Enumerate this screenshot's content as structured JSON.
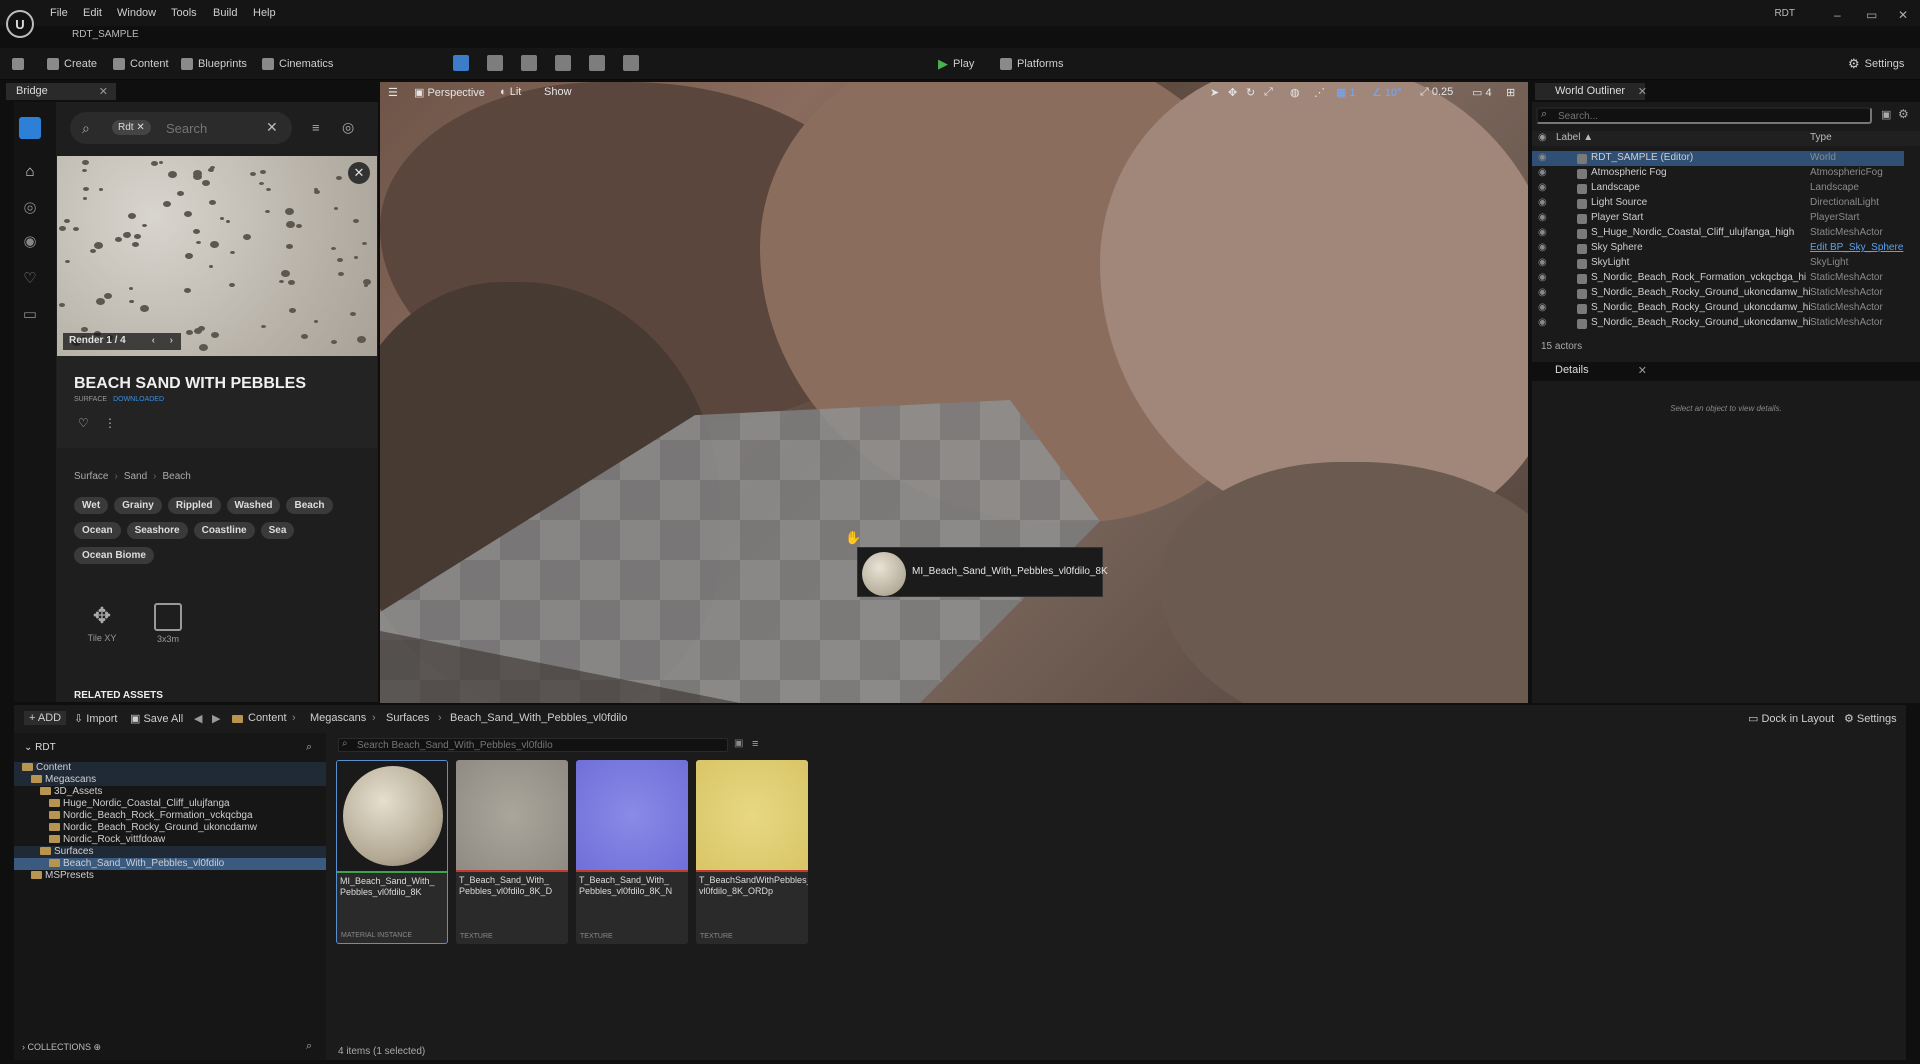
{
  "app": {
    "logo": "U",
    "menu": [
      "File",
      "Edit",
      "Window",
      "Tools",
      "Build",
      "Help"
    ],
    "project_tab": "RDT_SAMPLE",
    "project_short": "RDT",
    "window_controls": [
      "–",
      "▭",
      "✕"
    ]
  },
  "toolbar": {
    "save_icon": "save-icon",
    "create": "Create",
    "content": "Content",
    "blueprints": "Blueprints",
    "cinematics": "Cinematics",
    "play": "Play",
    "platforms": "Platforms",
    "settings": "Settings",
    "play_color": "#4caf50"
  },
  "bridge": {
    "tab": "Bridge",
    "search_chip": "Rdt",
    "search_placeholder": "Search",
    "render_label": "Render 1 / 4",
    "asset_title": "BEACH SAND WITH PEBBLES",
    "asset_type": "SURFACE",
    "asset_status": "DOWNLOADED",
    "status_color": "#3b8fe0",
    "breadcrumb": [
      "Surface",
      "Sand",
      "Beach"
    ],
    "tags": [
      "Wet",
      "Grainy",
      "Rippled",
      "Washed",
      "Beach",
      "Ocean",
      "Seashore",
      "Coastline",
      "Sea",
      "Ocean Biome"
    ],
    "tile_label": "Tile XY",
    "size_label": "3x3m",
    "related_title": "RELATED ASSETS"
  },
  "viewport": {
    "perspective": "Perspective",
    "lit": "Lit",
    "show": "Show",
    "grid_value": "1",
    "angle_value": "10°",
    "scale_value": "0.25",
    "camera_speed": "4",
    "drag_asset": "MI_Beach_Sand_With_Pebbles_vl0fdilo_8K"
  },
  "outliner": {
    "tab": "World Outliner",
    "search_placeholder": "Search...",
    "col_label": "Label ▲",
    "col_type": "Type",
    "rows": [
      {
        "label": "RDT_SAMPLE (Editor)",
        "type": "World"
      },
      {
        "label": "Atmospheric Fog",
        "type": "AtmosphericFog"
      },
      {
        "label": "Landscape",
        "type": "Landscape"
      },
      {
        "label": "Light Source",
        "type": "DirectionalLight"
      },
      {
        "label": "Player Start",
        "type": "PlayerStart"
      },
      {
        "label": "S_Huge_Nordic_Coastal_Cliff_ulujfanga_high",
        "type": "StaticMeshActor"
      },
      {
        "label": "Sky Sphere",
        "type": "Edit BP_Sky_Sphere"
      },
      {
        "label": "SkyLight",
        "type": "SkyLight"
      },
      {
        "label": "S_Nordic_Beach_Rock_Formation_vckqcbga_hi",
        "type": "StaticMeshActor"
      },
      {
        "label": "S_Nordic_Beach_Rocky_Ground_ukoncdamw_hi",
        "type": "StaticMeshActor"
      },
      {
        "label": "S_Nordic_Beach_Rocky_Ground_ukoncdamw_hi",
        "type": "StaticMeshActor"
      },
      {
        "label": "S_Nordic_Beach_Rocky_Ground_ukoncdamw_hi",
        "type": "StaticMeshActor"
      }
    ],
    "actor_count": "15 actors",
    "link_color": "#5aa0f0"
  },
  "details": {
    "tab": "Details",
    "empty_text": "Select an object to view details."
  },
  "content_browser": {
    "add": "ADD",
    "import": "Import",
    "save_all": "Save All",
    "path": [
      "Content",
      "Megascans",
      "Surfaces",
      "Beach_Sand_With_Pebbles_vl0fdilo"
    ],
    "dock": "Dock in Layout",
    "settings": "Settings",
    "tree_root": "RDT",
    "search_placeholder": "Search Beach_Sand_With_Pebbles_vl0fdilo",
    "tree": [
      {
        "label": "Content",
        "depth": 0
      },
      {
        "label": "Megascans",
        "depth": 1
      },
      {
        "label": "3D_Assets",
        "depth": 2
      },
      {
        "label": "Huge_Nordic_Coastal_Cliff_ulujfanga",
        "depth": 3
      },
      {
        "label": "Nordic_Beach_Rock_Formation_vckqcbga",
        "depth": 3
      },
      {
        "label": "Nordic_Beach_Rocky_Ground_ukoncdamw",
        "depth": 3
      },
      {
        "label": "Nordic_Rock_vittfdoaw",
        "depth": 3
      },
      {
        "label": "Surfaces",
        "depth": 2
      },
      {
        "label": "Beach_Sand_With_Pebbles_vl0fdilo",
        "depth": 3
      },
      {
        "label": "MSPresets",
        "depth": 1
      }
    ],
    "assets": [
      {
        "name": "MI_Beach_Sand_With_Pebbles_vl0fdilo_8K",
        "display1": "MI_Beach_Sand_With_",
        "display2": "Pebbles_vl0fdilo_8K",
        "kind": "MATERIAL INSTANCE"
      },
      {
        "name": "T_Beach_Sand_With_Pebbles_vl0fdilo_8K_D",
        "display1": "T_Beach_Sand_With_",
        "display2": "Pebbles_vl0fdilo_8K_D",
        "kind": "TEXTURE"
      },
      {
        "name": "T_Beach_Sand_With_Pebbles_vl0fdilo_8K_N",
        "display1": "T_Beach_Sand_With_",
        "display2": "Pebbles_vl0fdilo_8K_N",
        "kind": "TEXTURE"
      },
      {
        "name": "T_BeachSandWithPebbles_vl0fdilo_8K_ORDp",
        "display1": "T_BeachSandWithPebbles_",
        "display2": "vl0fdilo_8K_ORDp",
        "kind": "TEXTURE"
      }
    ],
    "collections": "COLLECTIONS",
    "status": "4 items (1 selected)"
  }
}
